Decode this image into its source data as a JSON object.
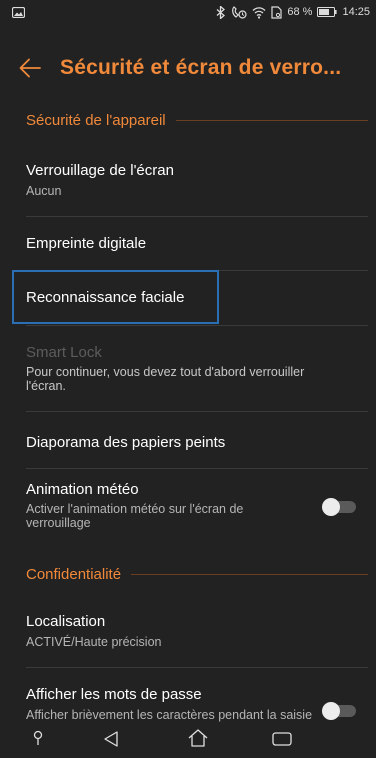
{
  "status_bar": {
    "battery": "68 %",
    "time": "14:25",
    "icons": [
      "image-icon",
      "bluetooth-icon",
      "phone-alarm-icon",
      "wifi-icon",
      "sim-icon",
      "battery-icon"
    ]
  },
  "app_bar": {
    "title": "Sécurité et écran de verro..."
  },
  "sections": [
    {
      "header": "Sécurité de l'appareil",
      "items": [
        {
          "title": "Verrouillage de l'écran",
          "subtitle": "Aucun"
        },
        {
          "title": "Empreinte digitale"
        },
        {
          "title": "Reconnaissance faciale"
        },
        {
          "title": "Smart Lock",
          "subtitle": "Pour continuer, vous devez tout d'abord verrouiller l'écran.",
          "disabled": true
        },
        {
          "title": "Diaporama des papiers peints"
        },
        {
          "title": "Animation météo",
          "subtitle": "Activer l'animation météo sur l'écran de verrouillage",
          "toggle": false
        }
      ]
    },
    {
      "header": "Confidentialité",
      "items": [
        {
          "title": "Localisation",
          "subtitle": "ACTIVÉ/Haute précision"
        },
        {
          "title": "Afficher les mots de passe",
          "subtitle": "Afficher brièvement les caractères pendant la saisie",
          "toggle": false
        }
      ]
    }
  ],
  "colors": {
    "background": "#222222",
    "accent": "#f0893a",
    "focus": "#2a6fb4"
  },
  "nav_icons": [
    "assistant-icon",
    "back-icon",
    "home-icon",
    "recents-icon"
  ]
}
